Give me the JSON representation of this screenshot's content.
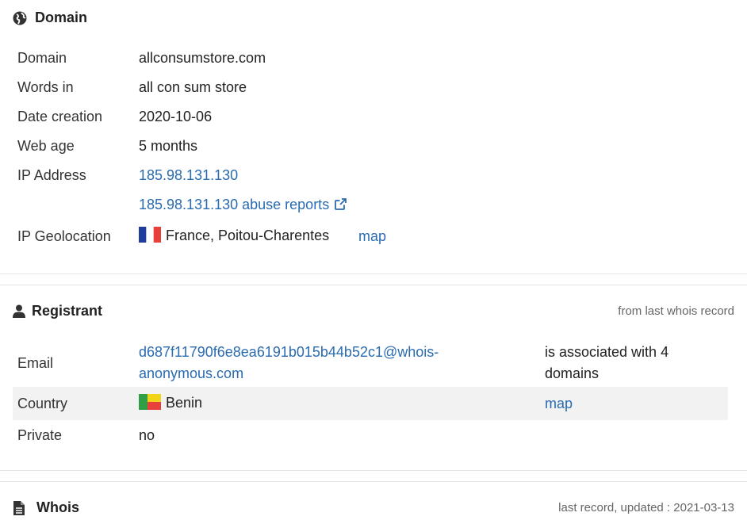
{
  "domain_section": {
    "title": "Domain",
    "icon": "globe-icon",
    "rows": {
      "domain": {
        "label": "Domain",
        "value": "allconsumstore.com"
      },
      "words": {
        "label": "Words in",
        "value": "all con sum store"
      },
      "date": {
        "label": "Date creation",
        "value": "2020-10-06"
      },
      "age": {
        "label": "Web age",
        "value": "5 months"
      },
      "ip": {
        "label": "IP Address",
        "value": "185.98.131.130"
      },
      "abuse": {
        "value": "185.98.131.130 abuse reports"
      },
      "geo": {
        "label": "IP Geolocation",
        "value": "France, Poitou-Charentes",
        "map": "map"
      }
    }
  },
  "registrant_section": {
    "title": "Registrant",
    "icon": "user-icon",
    "note": "from last whois record",
    "rows": {
      "email": {
        "label": "Email",
        "value_line1": "d687f11790f6e8ea6191b015b44b52c1@whois-",
        "value_line2": "anonymous.com",
        "assoc_line1": "is associated with 4",
        "assoc_line2": "domains"
      },
      "country": {
        "label": "Country",
        "value": "Benin",
        "map": "map"
      },
      "private": {
        "label": "Private",
        "value": "no"
      }
    }
  },
  "whois_section": {
    "title": "Whois",
    "icon": "document-icon",
    "note": "last record, updated : 2021-03-13"
  },
  "colors": {
    "link": "#2a6bb0",
    "stripe": "#f2f2f2",
    "divider": "#e3e3e3"
  }
}
